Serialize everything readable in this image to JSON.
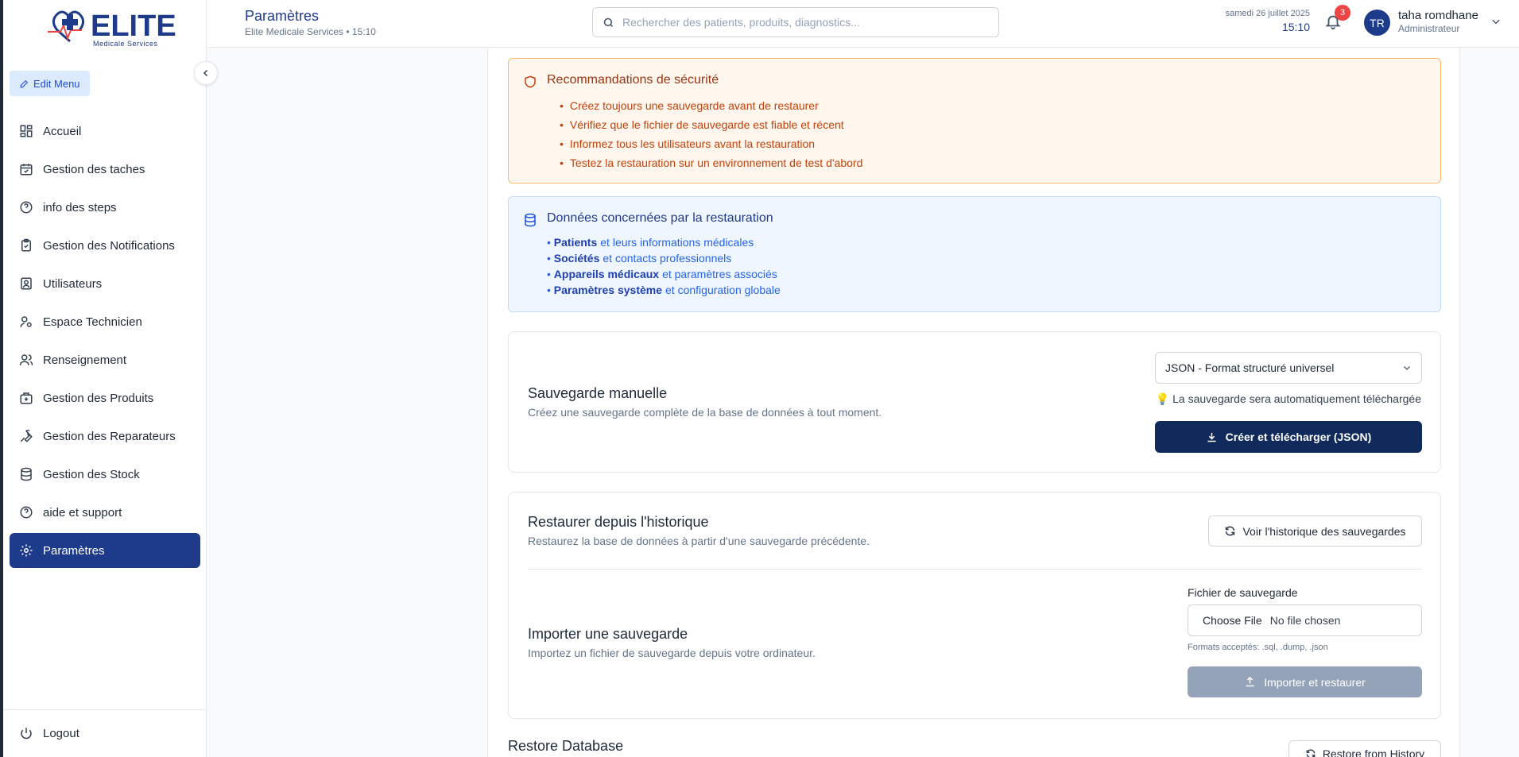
{
  "brand": {
    "name": "ELITE",
    "tagline": "Medicale Services"
  },
  "sidebar": {
    "edit_menu": "Edit Menu",
    "items": [
      {
        "label": "Accueil",
        "icon": "dashboard-icon"
      },
      {
        "label": "Gestion des taches",
        "icon": "calendar-check-icon"
      },
      {
        "label": "info des steps",
        "icon": "help-circle-icon"
      },
      {
        "label": "Gestion des Notifications",
        "icon": "clipboard-check-icon"
      },
      {
        "label": "Utilisateurs",
        "icon": "user-square-icon"
      },
      {
        "label": "Espace Technicien",
        "icon": "user-cog-icon"
      },
      {
        "label": "Renseignement",
        "icon": "users-icon"
      },
      {
        "label": "Gestion des Produits",
        "icon": "medical-bag-icon"
      },
      {
        "label": "Gestion des Reparateurs",
        "icon": "wrench-icon"
      },
      {
        "label": "Gestion des Stock",
        "icon": "database-icon"
      },
      {
        "label": "aide et support",
        "icon": "help-circle-icon"
      },
      {
        "label": "Paramètres",
        "icon": "gear-icon",
        "active": true
      }
    ],
    "logout": "Logout"
  },
  "header": {
    "title": "Paramètres",
    "subtitle": "Elite Medicale Services • 15:10",
    "search_placeholder": "Rechercher des patients, produits, diagnostics...",
    "date": "samedi 26 juillet 2025",
    "time": "15:10",
    "notification_count": "3",
    "user": {
      "initials": "TR",
      "name": "taha romdhane",
      "role": "Administrateur"
    }
  },
  "security": {
    "title": "Recommandations de sécurité",
    "items": [
      "Créez toujours une sauvegarde avant de restaurer",
      "Vérifiez que le fichier de sauvegarde est fiable et récent",
      "Informez tous les utilisateurs avant la restauration",
      "Testez la restauration sur un environnement de test d'abord"
    ]
  },
  "data_info": {
    "title": "Données concernées par la restauration",
    "lines": [
      {
        "bold": "Patients",
        "rest": "et leurs informations médicales"
      },
      {
        "bold": "Sociétés",
        "rest": "et contacts professionnels"
      },
      {
        "bold": "Appareils médicaux",
        "rest": "et paramètres associés"
      },
      {
        "bold": "Paramètres système",
        "rest": "et configuration globale"
      }
    ]
  },
  "manual_backup": {
    "title": "Sauvegarde manuelle",
    "description": "Créez une sauvegarde complète de la base de données à tout moment.",
    "format_selected": "JSON - Format structuré universel",
    "hint": "💡 La sauvegarde sera automatiquement téléchargée",
    "button": "Créer et télécharger (JSON)"
  },
  "restore_history": {
    "title": "Restaurer depuis l'historique",
    "description": "Restaurez la base de données à partir d'une sauvegarde précédente.",
    "button": "Voir l'historique des sauvegardes"
  },
  "import_backup": {
    "title": "Importer une sauvegarde",
    "description": "Importez un fichier de sauvegarde depuis votre ordinateur.",
    "file_label": "Fichier de sauvegarde",
    "choose_file": "Choose File",
    "no_file": "No file chosen",
    "formats": "Formats acceptés: .sql, .dump, .json",
    "button": "Importer et restaurer"
  },
  "restore_db": {
    "title": "Restore Database",
    "button": "Restore from History"
  }
}
